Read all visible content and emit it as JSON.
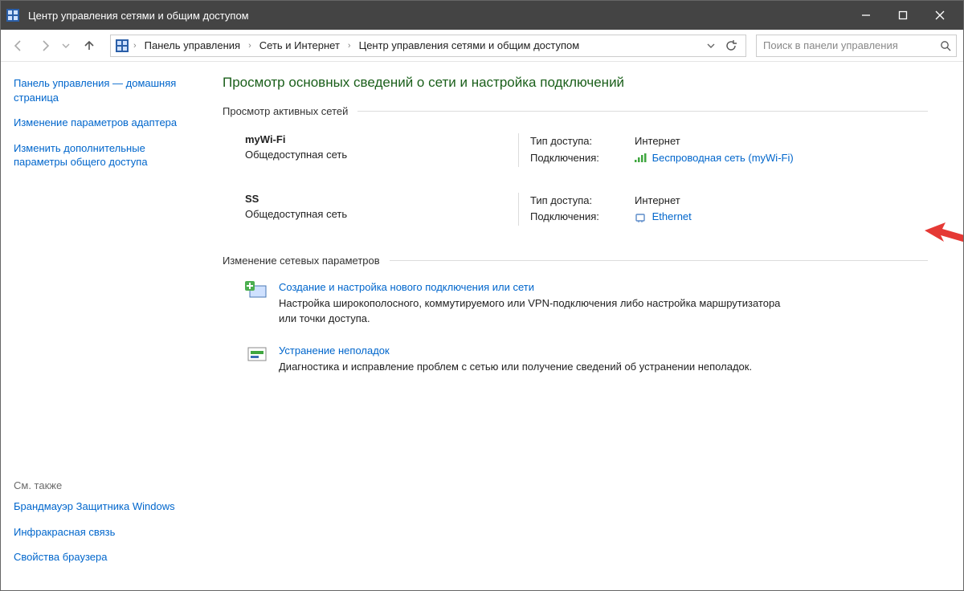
{
  "window": {
    "title": "Центр управления сетями и общим доступом"
  },
  "breadcrumb": {
    "root": "Панель управления",
    "mid": "Сеть и Интернет",
    "leaf": "Центр управления сетями и общим доступом"
  },
  "search": {
    "placeholder": "Поиск в панели управления"
  },
  "sidebar": {
    "home": "Панель управления — домашняя страница",
    "adapter": "Изменение параметров адаптера",
    "sharing": "Изменить дополнительные параметры общего доступа",
    "see_also_hdr": "См. также",
    "see_also": [
      "Брандмауэр Защитника Windows",
      "Инфракрасная связь",
      "Свойства браузера"
    ]
  },
  "main": {
    "page_title": "Просмотр основных сведений о сети и настройка подключений",
    "active_hdr": "Просмотр активных сетей",
    "change_hdr": "Изменение сетевых параметров",
    "labels": {
      "access": "Тип доступа:",
      "conn": "Подключения:"
    },
    "networks": [
      {
        "name": "myWi-Fi",
        "kind": "Общедоступная сеть",
        "access": "Интернет",
        "conn_label": "Беспроводная сеть (myWi-Fi)",
        "icon": "wifi"
      },
      {
        "name": "SS",
        "kind": "Общедоступная сеть",
        "access": "Интернет",
        "conn_label": "Ethernet",
        "icon": "ethernet"
      }
    ],
    "settings": [
      {
        "title": "Создание и настройка нового подключения или сети",
        "desc": "Настройка широкополосного, коммутируемого или VPN-подключения либо настройка маршрутизатора или точки доступа."
      },
      {
        "title": "Устранение неполадок",
        "desc": "Диагностика и исправление проблем с сетью или получение сведений об устранении неполадок."
      }
    ]
  }
}
